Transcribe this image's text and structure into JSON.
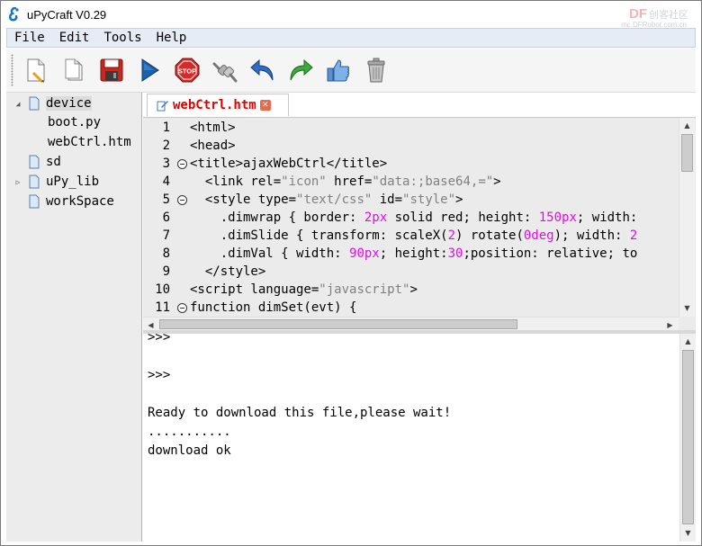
{
  "window": {
    "title": "uPyCraft V0.29",
    "watermark": "DF",
    "watermark_small": "创客社区",
    "watermark_sub": "mc.DFRobot.com.cn"
  },
  "menu": [
    "File",
    "Edit",
    "Tools",
    "Help"
  ],
  "toolbar": {
    "buttons": [
      "new-file",
      "open-file",
      "save",
      "run",
      "stop",
      "connect",
      "undo",
      "redo",
      "syntax-check",
      "clear"
    ]
  },
  "tree": {
    "nodes": [
      {
        "label": "device",
        "expanded": true
      },
      {
        "label": "boot.py"
      },
      {
        "label": "webCtrl.htm"
      },
      {
        "label": "sd"
      },
      {
        "label": "uPy_lib",
        "expandable": true
      },
      {
        "label": "workSpace"
      }
    ]
  },
  "tab": {
    "label": "webCtrl.htm"
  },
  "editor": {
    "line_numbers": [
      "1",
      "2",
      "3",
      "4",
      "5",
      "6",
      "7",
      "8",
      "9",
      "10",
      "11"
    ],
    "lines": [
      {
        "parts": [
          [
            "<html>",
            ""
          ]
        ]
      },
      {
        "parts": [
          [
            "<head>",
            ""
          ]
        ]
      },
      {
        "parts": [
          [
            "<title>ajaxWebCtrl</title>",
            ""
          ]
        ]
      },
      {
        "parts": [
          [
            "  <link rel=",
            ""
          ],
          [
            "\"icon\"",
            "str"
          ],
          [
            " href=",
            ""
          ],
          [
            "\"data:;base64,=\"",
            "str"
          ],
          [
            ">",
            ""
          ]
        ]
      },
      {
        "parts": [
          [
            "  <style type=",
            ""
          ],
          [
            "\"text/css\"",
            "str"
          ],
          [
            " id=",
            ""
          ],
          [
            "\"style\"",
            "str"
          ],
          [
            ">",
            ""
          ]
        ]
      },
      {
        "parts": [
          [
            "    .dimwrap { border: ",
            ""
          ],
          [
            "2px",
            "num"
          ],
          [
            " solid red; height: ",
            ""
          ],
          [
            "150px",
            "num"
          ],
          [
            "; width: ",
            ""
          ]
        ]
      },
      {
        "parts": [
          [
            "    .dimSlide { transform: scaleX(",
            ""
          ],
          [
            "2",
            "num"
          ],
          [
            ") rotate(",
            ""
          ],
          [
            "0deg",
            "num"
          ],
          [
            "); width: ",
            ""
          ],
          [
            "2",
            "num"
          ]
        ]
      },
      {
        "parts": [
          [
            "    .dimVal { width: ",
            ""
          ],
          [
            "90px",
            "num"
          ],
          [
            "; height:",
            ""
          ],
          [
            "30",
            "num"
          ],
          [
            ";position: relative; to",
            ""
          ]
        ]
      },
      {
        "parts": [
          [
            "  </style>",
            ""
          ]
        ]
      },
      {
        "parts": [
          [
            "<script language=",
            ""
          ],
          [
            "\"javascript\"",
            "str"
          ],
          [
            ">",
            ""
          ]
        ]
      },
      {
        "parts": [
          [
            "function dimSet(evt) {",
            ""
          ]
        ]
      }
    ]
  },
  "terminal": {
    "lines": [
      ">>>",
      "",
      ">>>",
      "",
      "Ready to download this file,please wait!",
      "...........",
      "download ok"
    ]
  },
  "colors": {
    "menubar_bg": "#e6ecf5",
    "tree_bg": "#ececec",
    "editor_bg": "#ebebeb",
    "tab_text": "#e00000",
    "string": "#808080",
    "number": "#e010e0"
  }
}
